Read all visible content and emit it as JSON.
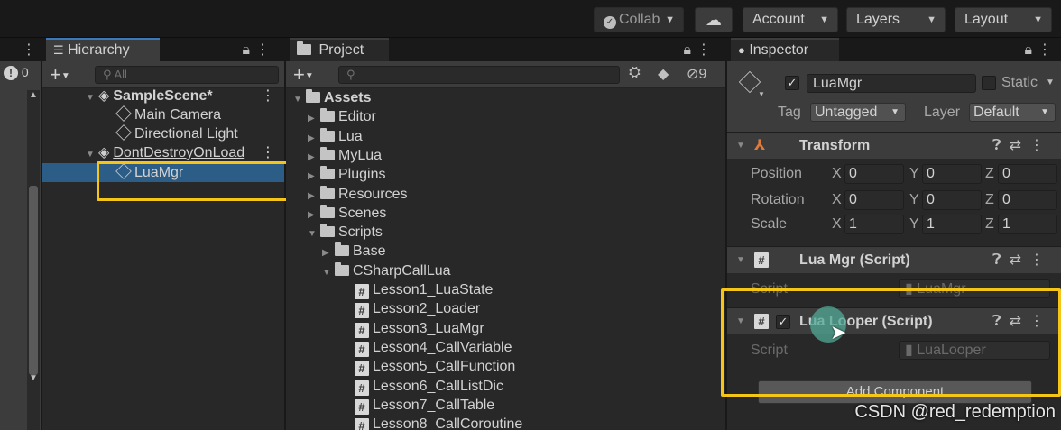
{
  "toolbar": {
    "collab": "Collab",
    "account": "Account",
    "layers": "Layers",
    "layout": "Layout",
    "cloud_icon": "cloud-icon"
  },
  "left_strip": {
    "badge": "0"
  },
  "hierarchy": {
    "tab": "Hierarchy",
    "search_placeholder": "All",
    "rows": [
      {
        "label": "SampleScene*",
        "kind": "scene"
      },
      {
        "label": "Main Camera",
        "kind": "object"
      },
      {
        "label": "Directional Light",
        "kind": "object"
      },
      {
        "label": "DontDestroyOnLoad",
        "kind": "scene"
      },
      {
        "label": "LuaMgr",
        "kind": "object",
        "selected": true
      }
    ]
  },
  "project": {
    "tab": "Project",
    "hidden_count": "9",
    "tree": [
      {
        "label": "Assets",
        "kind": "folder-open"
      },
      {
        "label": "Editor",
        "kind": "folder"
      },
      {
        "label": "Lua",
        "kind": "folder"
      },
      {
        "label": "MyLua",
        "kind": "folder"
      },
      {
        "label": "Plugins",
        "kind": "folder"
      },
      {
        "label": "Resources",
        "kind": "folder"
      },
      {
        "label": "Scenes",
        "kind": "folder"
      },
      {
        "label": "Scripts",
        "kind": "folder-open"
      },
      {
        "label": "Base",
        "kind": "folder"
      },
      {
        "label": "CSharpCallLua",
        "kind": "folder-open"
      },
      {
        "label": "Lesson1_LuaState",
        "kind": "script"
      },
      {
        "label": "Lesson2_Loader",
        "kind": "script"
      },
      {
        "label": "Lesson3_LuaMgr",
        "kind": "script"
      },
      {
        "label": "Lesson4_CallVariable",
        "kind": "script"
      },
      {
        "label": "Lesson5_CallFunction",
        "kind": "script"
      },
      {
        "label": "Lesson6_CallListDic",
        "kind": "script"
      },
      {
        "label": "Lesson7_CallTable",
        "kind": "script"
      },
      {
        "label": "Lesson8_CallCoroutine",
        "kind": "script"
      }
    ]
  },
  "inspector": {
    "tab": "Inspector",
    "object_name": "LuaMgr",
    "static_label": "Static",
    "tag_label": "Tag",
    "tag_value": "Untagged",
    "layer_label": "Layer",
    "layer_value": "Default",
    "transform": {
      "title": "Transform",
      "position_label": "Position",
      "rotation_label": "Rotation",
      "scale_label": "Scale",
      "axis_x": "X",
      "axis_y": "Y",
      "axis_z": "Z",
      "position": [
        "0",
        "0",
        "0"
      ],
      "rotation": [
        "0",
        "0",
        "0"
      ],
      "scale": [
        "1",
        "1",
        "1"
      ]
    },
    "lua_mgr": {
      "title": "Lua Mgr (Script)",
      "script_label": "Script",
      "script_value": "LuaMgr"
    },
    "lua_looper": {
      "title": "Lua Looper (Script)",
      "script_label": "Script",
      "script_value": "LuaLooper"
    },
    "add_component": "Add Component"
  },
  "watermark": "CSDN @red_redemption",
  "colors": {
    "highlight": "#f5c518",
    "selection": "#2c5d87",
    "tab_accent": "#3a79bb"
  }
}
